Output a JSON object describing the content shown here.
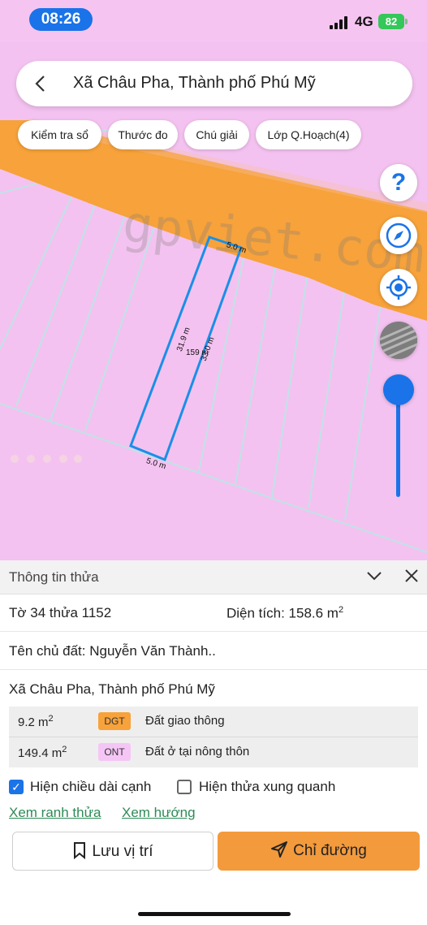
{
  "status_bar": {
    "time": "08:26",
    "network": "4G",
    "battery": "82"
  },
  "search": {
    "title": "Xã Châu Pha, Thành phố Phú Mỹ"
  },
  "toolbar": {
    "chips": [
      "Kiểm tra sổ",
      "Thước đo",
      "Chú giải",
      "Lớp Q.Hoạch(4)"
    ]
  },
  "map": {
    "watermark": "gpviet.com",
    "labels": {
      "top_edge": "5.0 m",
      "bottom_edge": "5.0 m",
      "left_edge": "31.9 m",
      "right_edge": "33.0 m",
      "area": "159 m"
    },
    "colors": {
      "land": "#f4c2f0",
      "road": "#f7a23a",
      "parcel_outline": "#1a8fe8",
      "accent": "#1a73e8"
    },
    "zoom_slider_level": 0
  },
  "fab": {
    "help": "?"
  },
  "panel": {
    "title": "Thông tin thửa",
    "sheet_parcel": "Tờ 34 thửa 1152",
    "area_label": "Diện tích: 158.6 m",
    "area_unit_exp": "2",
    "owner": "Tên chủ đất: Nguyễn Văn Thành..",
    "address": "Xã Châu Pha, Thành phố Phú Mỹ",
    "land_use": [
      {
        "area": "9.2 m",
        "exp": "2",
        "code": "DGT",
        "code_color": "#f7a23a",
        "description": "Đất giao thông"
      },
      {
        "area": "149.4 m",
        "exp": "2",
        "code": "ONT",
        "code_color": "#f5c6f5",
        "description": "Đất ở tại nông thôn"
      }
    ],
    "checkbox_edges": {
      "label": "Hiện chiều dài cạnh",
      "checked": true
    },
    "checkbox_neighbors": {
      "label": "Hiện thửa xung quanh",
      "checked": false
    },
    "link_boundary": "Xem ranh thửa",
    "link_direction": "Xem hướng",
    "save_button": "Lưu vị trí",
    "directions_button": "Chỉ đường"
  }
}
